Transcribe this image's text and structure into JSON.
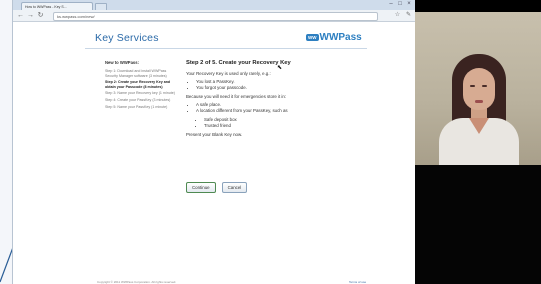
{
  "browser": {
    "tab_title": "How to WWPass - Key S...",
    "url": "ks.wwpass.com/new/",
    "icons": [
      "back-icon",
      "forward-icon",
      "reload-icon",
      "star-icon",
      "wrench-icon"
    ]
  },
  "header": {
    "title": "Key Services",
    "logo_badge": "WW",
    "logo_text": "WWPass"
  },
  "sidebar": {
    "heading": "New to WWPass:",
    "steps": [
      "Step 1: Download and install WWPass Security Manager software (3 minutes)",
      "Step 2: Create your Recovery Key and obtain your Passcode (8 minutes)",
      "Step 3: Name your Recovery key (1 minute)",
      "Step 4: Create your PassKey (3 minutes)",
      "Step 5: Name your PassKey (1 minute)"
    ]
  },
  "main": {
    "title": "Step 2 of 5. Create your Recovery Key",
    "intro": "Your Recovery Key is used only rarely, e.g.:",
    "reasons": [
      "You lost a PassKey.",
      "You forgot your passcode."
    ],
    "storage_intro": "Because you will need it for emergencies store it in:",
    "storage": [
      "A safe place.",
      "A location different from your PassKey, such as"
    ],
    "storage_sub": [
      "Safe deposit box",
      "Trusted friend"
    ],
    "prompt": "Present your Blank Key now.",
    "continue_label": "Continue",
    "cancel_label": "Cancel"
  },
  "footer": {
    "copyright": "Copyright © 2011 WWPass Corporation. All rights reserved.",
    "link": "Terms of use"
  },
  "colors": {
    "brand": "#2b6aa8",
    "logo": "#2d7fc1"
  }
}
